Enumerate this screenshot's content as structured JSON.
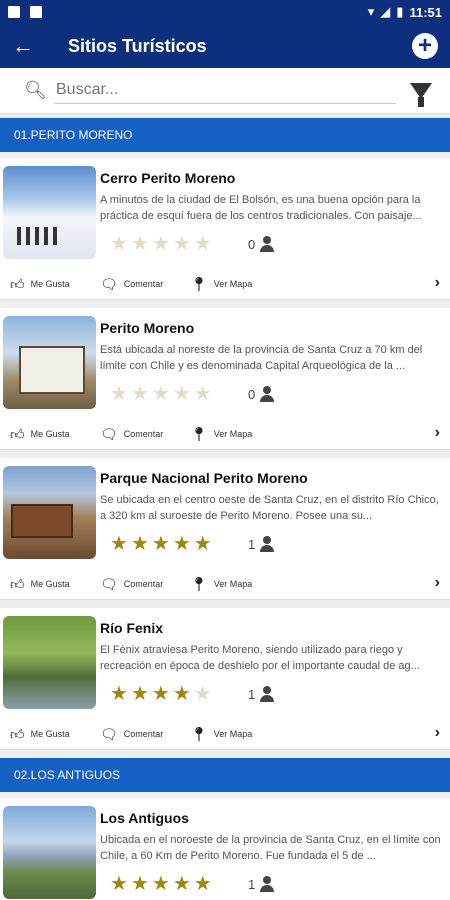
{
  "status_bar": {
    "time": "11:51"
  },
  "app_bar": {
    "title": "Sitios Turísticos",
    "back_icon": "←",
    "add_icon": "+"
  },
  "search": {
    "placeholder": "Buscar..."
  },
  "sections": [
    {
      "header": "01.PERITO MORENO",
      "items": [
        {
          "name": "Cerro Perito Moreno",
          "desc": "A minutos de la ciudad de El Bolsón, es una buena opción para la práctica de esquí fuera de los centros tradicionales. Con paisaje...",
          "rating": 0,
          "count": "0",
          "image": "snow-mountain-skiers"
        },
        {
          "name": "Perito Moreno",
          "desc": "Está ubicada al noreste de la provincia de Santa Cruz a 70 km del límite con Chile y es denominada Capital Arqueológica de la ...",
          "rating": 0,
          "count": "0",
          "image": "welcome-sign"
        },
        {
          "name": "Parque Nacional Perito Moreno",
          "desc": "Se ubicada en el centro oeste de Santa Cruz, en el distrito Río Chico, a 320 km al suroeste de Perito Moreno. Posee una su...",
          "rating": 5,
          "count": "1",
          "image": "park-sign"
        },
        {
          "name": "Río Fenix",
          "desc": "El Fénix  atraviesa Perito Moreno, siendo utilizado para riego y recreación en época de deshielo por el importante caudal de ag...",
          "rating": 4,
          "count": "1",
          "image": "river-trees"
        }
      ]
    },
    {
      "header": "02.LOS ANTIGUOS",
      "items": [
        {
          "name": "Los Antiguos",
          "desc": "Ubicada en el noroeste de la provincia de Santa Cruz, en el límite con Chile, a 60 Km de Perito Moreno. Fue fundada el 5 de ...",
          "rating": 5,
          "count": "1",
          "image": "lake-landscape"
        }
      ]
    }
  ],
  "actions": {
    "like": "Me Gusta",
    "comment": "Comentar",
    "map": "Ver Mapa"
  },
  "colors": {
    "primary": "#0d2f7d",
    "section": "#1460c3",
    "star_on": "#a4860f",
    "star_off": "#e6dcc4"
  }
}
